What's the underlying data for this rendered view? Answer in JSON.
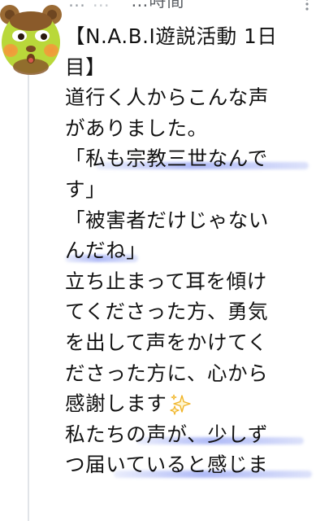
{
  "header": {
    "display_name": "…",
    "handle": "…",
    "timestamp": "…時間",
    "more_icon": "more-options-icon"
  },
  "avatar": {
    "icon": "bear-avatar-icon"
  },
  "post": {
    "lines": [
      "【N.A.B.I遊説活動 1日",
      "目】",
      "道行く人からこんな声",
      "がありました。",
      "「私も宗教三世なんで",
      "す」",
      "「被害者だけじゃない",
      "んだね」",
      "立ち止まって耳を傾け",
      "てくださった方、勇気",
      "を出して声をかけてく",
      "ださった方に、心から",
      "感謝します",
      "私たちの声が、少しず",
      "つ届いていると感じま"
    ],
    "emoji_icon": "sparkles-icon"
  },
  "colors": {
    "text": "#111111",
    "highlight": "#6f82f0",
    "avatar_face": "#b9d83a",
    "avatar_ear": "#9a6a34"
  }
}
